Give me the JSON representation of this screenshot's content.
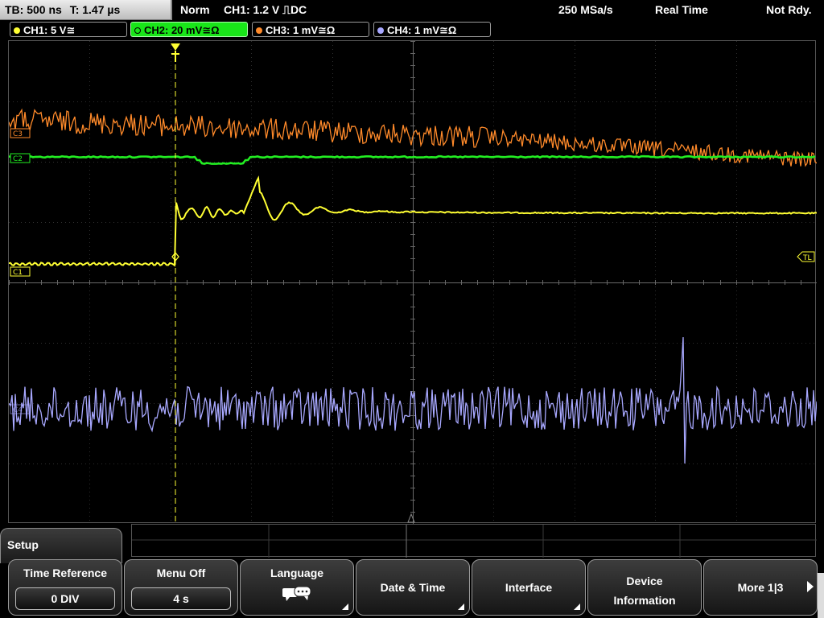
{
  "topbar": {
    "timebase": "TB: 500 ns",
    "trigger_time": "T: 1.47 µs",
    "mode": "Norm",
    "trigger": "CH1: 1.2 V ⎍DC",
    "sample_rate": "250 MSa/s",
    "acq_mode": "Real Time",
    "state": "Not Rdy."
  },
  "channels": [
    {
      "label": "CH1: 5 V≅",
      "color": "#ffff33"
    },
    {
      "label": "CH2: 20 mV≅Ω",
      "color": "#22ee22"
    },
    {
      "label": "CH3: 1 mV≅Ω",
      "color": "#ff8a2a"
    },
    {
      "label": "CH4: 1 mV≅Ω",
      "color": "#a8a8ff"
    }
  ],
  "markers": {
    "ch1": "C1",
    "ch2": "C2",
    "ch3": "C3",
    "ch4": "C4",
    "trigger_level": "TL"
  },
  "menu": {
    "title": "Setup",
    "softkeys": {
      "time_reference": {
        "label": "Time Reference",
        "value": "0 DIV"
      },
      "menu_off": {
        "label": "Menu Off",
        "value": "4 s"
      },
      "language": {
        "label": "Language",
        "icon": "speech-bubbles-icon"
      },
      "date_time": {
        "label": "Date & Time"
      },
      "interface": {
        "label": "Interface"
      },
      "device_info": {
        "line1": "Device",
        "line2": "Information"
      },
      "more": {
        "label": "More 1|3"
      }
    }
  }
}
